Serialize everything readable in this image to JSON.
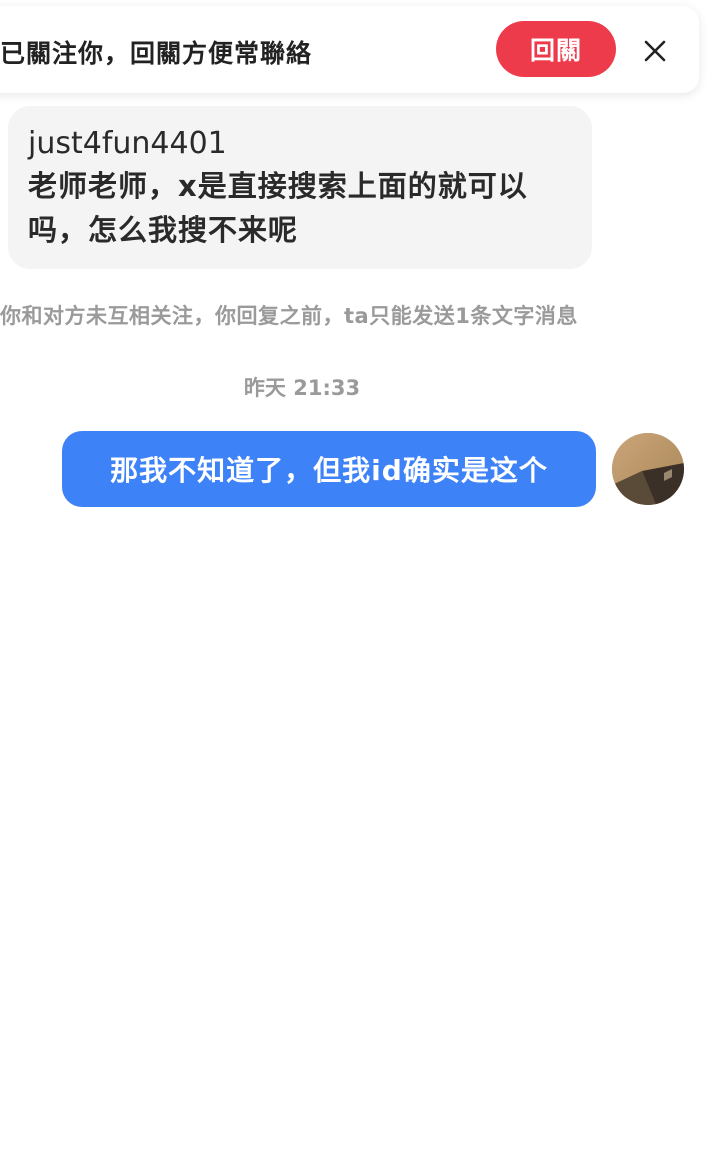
{
  "banner": {
    "text": "已關注你，回關方便常聯絡",
    "follow_back_label": "回關",
    "close_icon": "close-icon",
    "accent_color": "#ee3b4b"
  },
  "messages": {
    "incoming": {
      "username": "just4fun4401",
      "text": "老师老师，x是直接搜索上面的就可以吗，怎么我搜不来呢"
    },
    "system_notice": "你和对方未互相关注，你回复之前，ta只能发送1条文字消息",
    "timestamp": "昨天 21:33",
    "outgoing": {
      "text": "那我不知道了，但我id确实是这个",
      "bubble_color": "#3d82f6"
    }
  },
  "avatar": {
    "icon": "avatar"
  }
}
